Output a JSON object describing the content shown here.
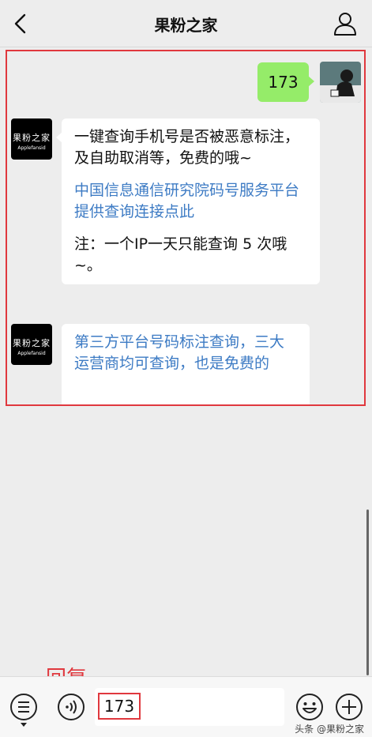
{
  "nav": {
    "title": "果粉之家"
  },
  "chat": {
    "sent_message": "173",
    "bot_avatar_cn": "果粉之家",
    "bot_avatar_en": "Applefansid",
    "reply1": {
      "intro": "一键查询手机号是否被恶意标注，及自助取消等，免费的哦~",
      "link": "中国信息通信研究院码号服务平台提供查询连接点此",
      "note": "注：一个IP一天只能查询 5 次哦~。"
    },
    "reply2": {
      "link": "第三方平台号码标注查询，三大运营商均可查询，也是免费的"
    }
  },
  "annotation": {
    "reply_label": "回复"
  },
  "input_bar": {
    "value": "173"
  },
  "watermark": "头条 @果粉之家"
}
